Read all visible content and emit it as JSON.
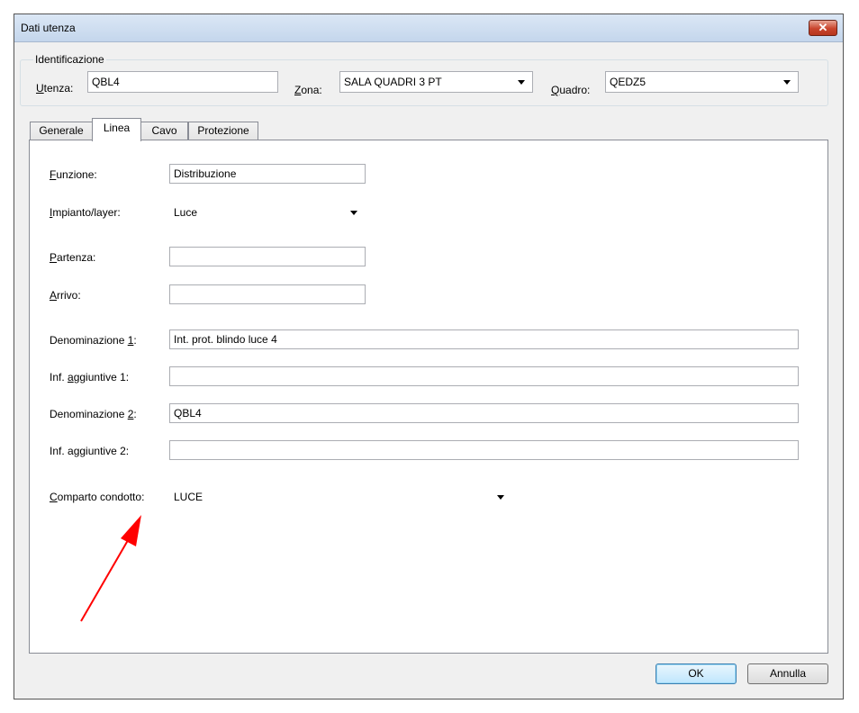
{
  "window": {
    "title": "Dati utenza",
    "close_glyph": "✕"
  },
  "identificazione": {
    "label": "Identificazione",
    "utenza": {
      "label_u": "U",
      "label_rest": "tenza:",
      "value": "QBL4"
    },
    "zona": {
      "label_u": "Z",
      "label_rest": "ona:",
      "value": "SALA QUADRI 3 PT"
    },
    "quadro": {
      "label_u": "Q",
      "label_rest": "uadro:",
      "value": "QEDZ5"
    }
  },
  "tabs": [
    {
      "label": "Generale"
    },
    {
      "label": "Linea"
    },
    {
      "label": "Cavo"
    },
    {
      "label": "Protezione"
    }
  ],
  "form": {
    "funzione": {
      "label_u": "F",
      "label_rest": "unzione:",
      "value": "Distribuzione"
    },
    "impianto": {
      "label_u": "I",
      "label_rest": "mpianto/layer:",
      "value": "Luce"
    },
    "partenza": {
      "label_u": "P",
      "label_rest": "artenza:",
      "value": ""
    },
    "arrivo": {
      "label_u": "A",
      "label_rest": "rrivo:",
      "value": ""
    },
    "denom1": {
      "label_pre": "Denominazione ",
      "label_u": "1",
      "label_post": ":",
      "value": "Int. prot. blindo luce 4"
    },
    "inf1": {
      "label_pre": "Inf. ",
      "label_u": "a",
      "label_post": "ggiuntive 1:",
      "value": ""
    },
    "denom2": {
      "label_pre": "Denominazione ",
      "label_u": "2",
      "label_post": ":",
      "value": "QBL4"
    },
    "inf2": {
      "label_pre": "Inf. a",
      "label_u": "g",
      "label_post": "giuntive 2:",
      "value": ""
    },
    "comparto": {
      "label_u": "C",
      "label_rest": "omparto condotto:",
      "value": "LUCE"
    }
  },
  "buttons": {
    "ok": "OK",
    "annulla": "Annulla"
  },
  "annotation": {
    "color": "#ff0000"
  }
}
